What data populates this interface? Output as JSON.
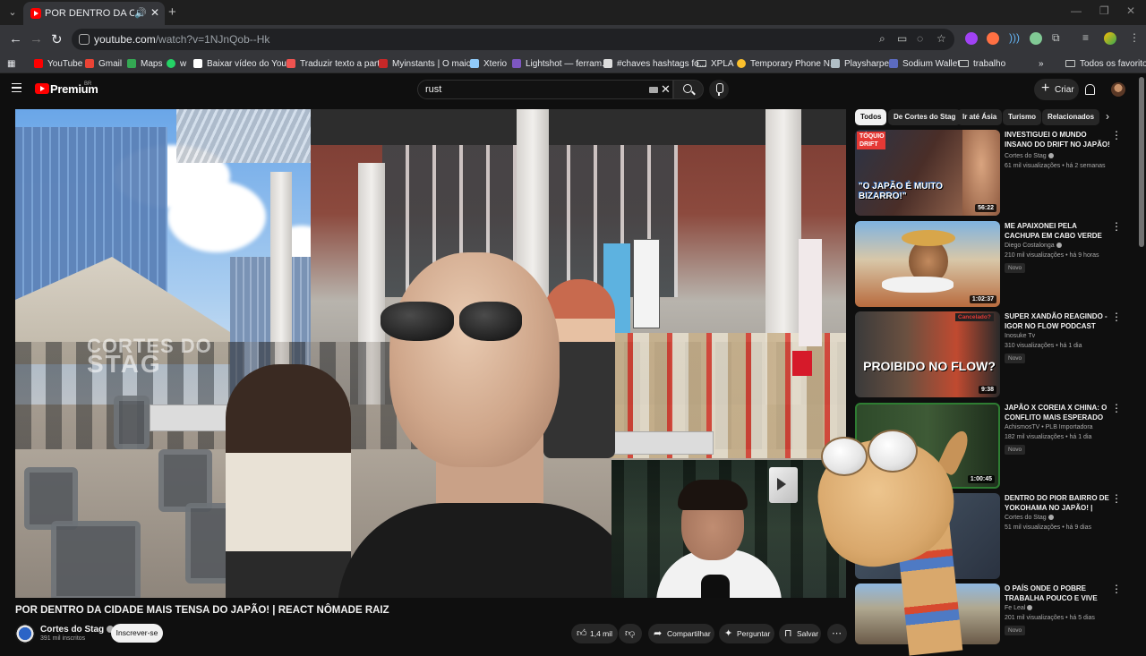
{
  "browser": {
    "tab_title": "POR DENTRO DA CIDADE MAIS TENSA DO JAPÃO! | REACT NÔMADE RAIZ",
    "url_host": "youtube.com",
    "url_path": "/watch?v=1NJnQob--Hk",
    "bookmarks": [
      {
        "label": "YouTube",
        "color": "#ff0000"
      },
      {
        "label": "Gmail",
        "color": "#ea4335"
      },
      {
        "label": "Maps",
        "color": "#34a853"
      },
      {
        "label": "w",
        "color": "#25d366"
      },
      {
        "label": "Baixar vídeo do You...",
        "color": "#ffffff"
      },
      {
        "label": "Traduzir texto a part...",
        "color": "#ef5350"
      },
      {
        "label": "Myinstants | O maio...",
        "color": "#c62828"
      },
      {
        "label": "Xterio",
        "color": "#90caf9"
      },
      {
        "label": "Lightshot — ferram...",
        "color": "#7e57c2"
      },
      {
        "label": "#chaves hashtags fo...",
        "color": "#dddddd"
      },
      {
        "label": "XPLA",
        "color": "folder"
      },
      {
        "label": "Temporary Phone N...",
        "color": "#fbc02d"
      },
      {
        "label": "Playsharper",
        "color": "#b0bec5"
      },
      {
        "label": "Sodium Wallet",
        "color": "#5c6bc0"
      },
      {
        "label": "trabalho",
        "color": "folder"
      }
    ],
    "overflow": "»",
    "all_bookmarks": "Todos os favoritos"
  },
  "youtube": {
    "logo_text": "Premium",
    "logo_sup": "BR",
    "search_query": "rust",
    "create_label": "Criar"
  },
  "video": {
    "title": "POR DENTRO DA CIDADE MAIS TENSA DO JAPÃO! | REACT NÔMADE RAIZ",
    "watermark_line1": "CORTES DO",
    "watermark_line2": "STAG",
    "channel": "Cortes do Stag",
    "subscribers": "391 mil inscritos",
    "subscribe_label": "Inscrever-se",
    "likes": "1,4 mil",
    "share_label": "Compartilhar",
    "ask_label": "Perguntar",
    "save_label": "Salvar"
  },
  "sidebar": {
    "chips": [
      "Todos",
      "De Cortes do Stag",
      "Ir até Ásia",
      "Turismo",
      "Relacionados"
    ],
    "recommendations": [
      {
        "title": "INVESTIGUEI O MUNDO INSANO DO DRIFT NO JAPÃO! | REACT ...",
        "channel": "Cortes do Stag",
        "meta": "61 mil visualizações • há 2 semanas",
        "duration": "56:22",
        "thumb_text": "\"O JAPÃO É MUITO BIZARRO!\"",
        "thumb_tag": "TÓQUIO DRIFT",
        "badge": ""
      },
      {
        "title": "ME APAIXONEI PELA CACHUPA EM CABO VERDE",
        "channel": "Diego Costalonga",
        "meta": "210 mil visualizações • há 9 horas",
        "duration": "1:02:37",
        "thumb_text": "",
        "thumb_tag": "",
        "badge": "Novo"
      },
      {
        "title": "SUPER XANDÃO REAGINDO - IGOR NO FLOW PODCAST FALANDO ...",
        "channel": "Inosuke Tv",
        "meta": "310 visualizações • há 1 dia",
        "duration": "9:38",
        "thumb_text": "PROIBIDO NO FLOW?",
        "thumb_tag": "Cancelado?",
        "badge": "Novo"
      },
      {
        "title": "JAPÃO X COREIA X CHINA: O CONFLITO MAIS ESPERADO DO ...",
        "channel": "AchismosTV • PLB Importadora",
        "meta": "182 mil visualizações • há 1 dia",
        "duration": "1:00:45",
        "thumb_text": "",
        "thumb_tag": "",
        "badge": "Novo"
      },
      {
        "title": "DENTRO DO PIOR BAIRRO DE YOKOHAMA NO JAPÃO! | REACT ...",
        "channel": "Cortes do Stag",
        "meta": "51 mil visualizações • há 9 dias",
        "duration": "",
        "thumb_text": "",
        "thumb_tag": "",
        "badge": ""
      },
      {
        "title": "O PAÍS ONDE O POBRE TRABALHA POUCO E VIVE COMO RICO",
        "channel": "Fe Leal",
        "meta": "201 mil visualizações • há 5 dias",
        "duration": "",
        "thumb_text": "",
        "thumb_tag": "",
        "badge": "Novo"
      }
    ]
  },
  "colors": {
    "background": "#0f0f0f",
    "accent_red": "#ff0000",
    "text": "#f1f1f1",
    "secondary_text": "#aaaaaa"
  }
}
